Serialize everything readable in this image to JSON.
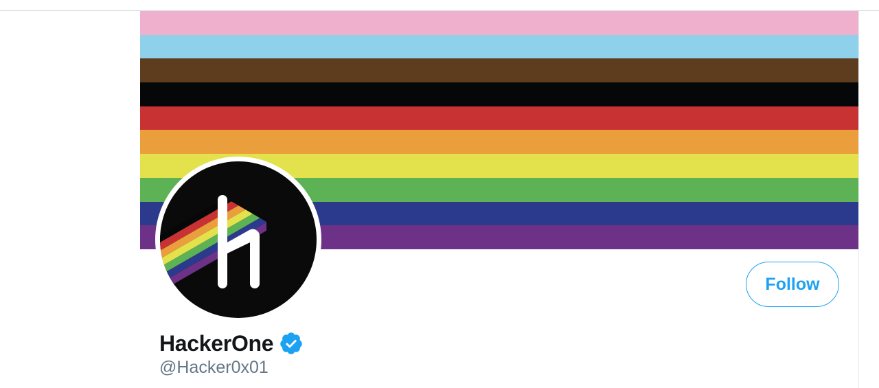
{
  "profile": {
    "display_name": "HackerOne",
    "handle": "@Hacker0x01",
    "verified": true,
    "verified_icon": "verified-badge-icon",
    "avatar_icon": "hackerone-logo-icon"
  },
  "actions": {
    "follow_label": "Follow"
  },
  "banner": {
    "stripes": [
      "#efb0ce",
      "#8fd0ea",
      "#5e3d1f",
      "#060708",
      "#c93232",
      "#eb9f3c",
      "#e3e24c",
      "#5cb255",
      "#2c3a8d",
      "#6d3287"
    ]
  },
  "colors": {
    "accent": "#1da1f2",
    "name": "#14171a",
    "handle": "#657786"
  }
}
